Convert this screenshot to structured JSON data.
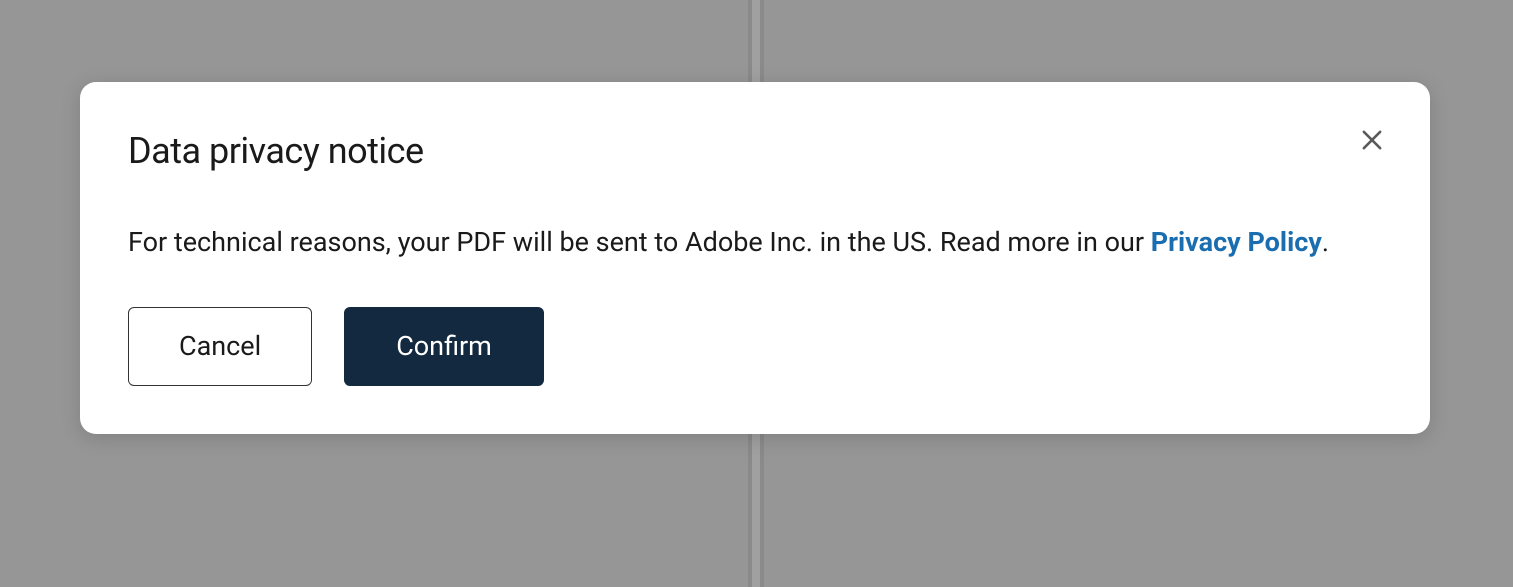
{
  "modal": {
    "title": "Data privacy notice",
    "body_text_before_link": "For technical reasons, your PDF will be sent to Adobe Inc. in the US. Read more in our ",
    "privacy_link_label": "Privacy Policy",
    "body_text_after_link": ".",
    "cancel_label": "Cancel",
    "confirm_label": "Confirm"
  }
}
